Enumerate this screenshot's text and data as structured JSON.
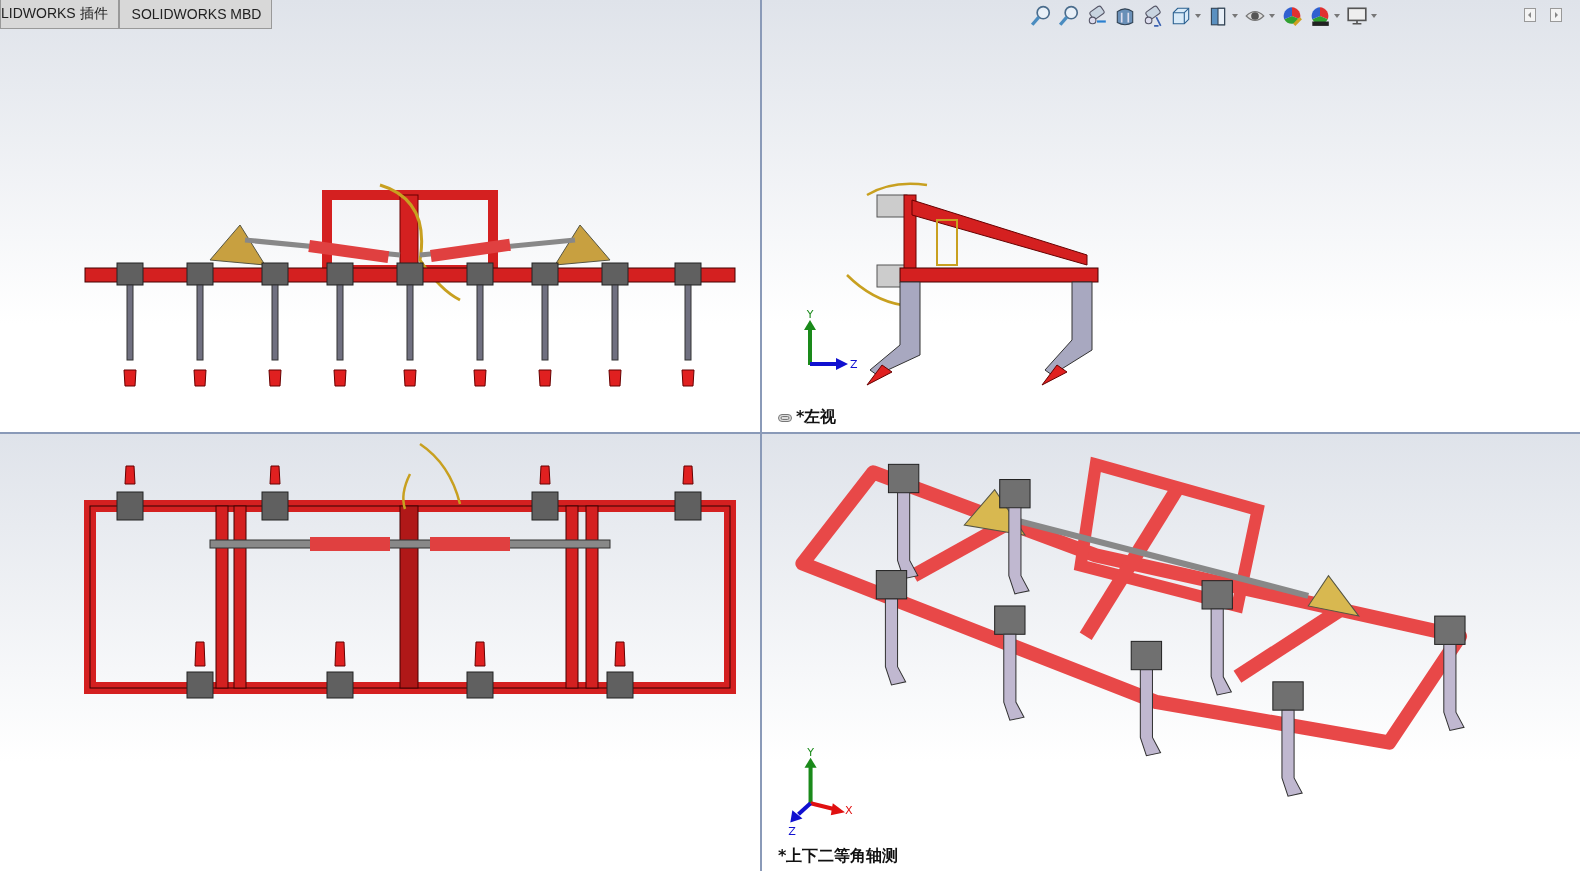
{
  "tabs": [
    {
      "label": "LIDWORKS 插件",
      "selected": false
    },
    {
      "label": "SOLIDWORKS MBD",
      "selected": false
    }
  ],
  "toolbar": {
    "items": [
      {
        "kind": "zoom-fit",
        "menu": false
      },
      {
        "kind": "zoom-area",
        "menu": false
      },
      {
        "kind": "previous-view",
        "menu": false
      },
      {
        "kind": "section-view",
        "menu": false
      },
      {
        "kind": "dynamic-annotation",
        "menu": false
      },
      {
        "kind": "view-orientation",
        "menu": true
      },
      {
        "kind": "display-style",
        "menu": true
      },
      {
        "kind": "hide-show",
        "menu": true
      },
      {
        "kind": "edit-appearance",
        "menu": false
      },
      {
        "kind": "apply-scene",
        "menu": true
      },
      {
        "kind": "view-settings",
        "menu": true
      }
    ]
  },
  "viewports": [
    {
      "kind": "front"
    },
    {
      "kind": "left",
      "label": "*左视",
      "linked": true,
      "axes": [
        "Y",
        "Z"
      ]
    },
    {
      "kind": "top"
    },
    {
      "kind": "iso",
      "label": "*上下二等角轴测",
      "linked": false,
      "axes": [
        "Y",
        "X",
        "Z"
      ]
    }
  ]
}
